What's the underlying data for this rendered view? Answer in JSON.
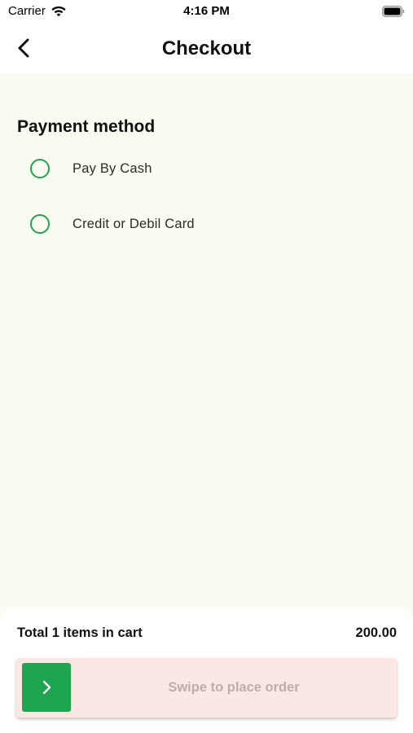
{
  "status_bar": {
    "carrier": "Carrier",
    "time": "4:16 PM"
  },
  "nav": {
    "title": "Checkout",
    "back_icon": "chevron-left-icon"
  },
  "payment": {
    "section_title": "Payment method",
    "options": [
      {
        "label": "Pay By Cash",
        "selected": false
      },
      {
        "label": "Credit or Debil Card",
        "selected": false
      }
    ]
  },
  "cart": {
    "total_label": "Total 1 items in cart",
    "total_value": "200.00"
  },
  "swipe": {
    "label": "Swipe to place order",
    "handle_icon": "chevron-right-icon"
  },
  "colors": {
    "accent": "#1fa44f",
    "content_bg": "#fbfcf1",
    "swipe_bg": "#fbe8e4",
    "swipe_text": "#b9aeac"
  }
}
